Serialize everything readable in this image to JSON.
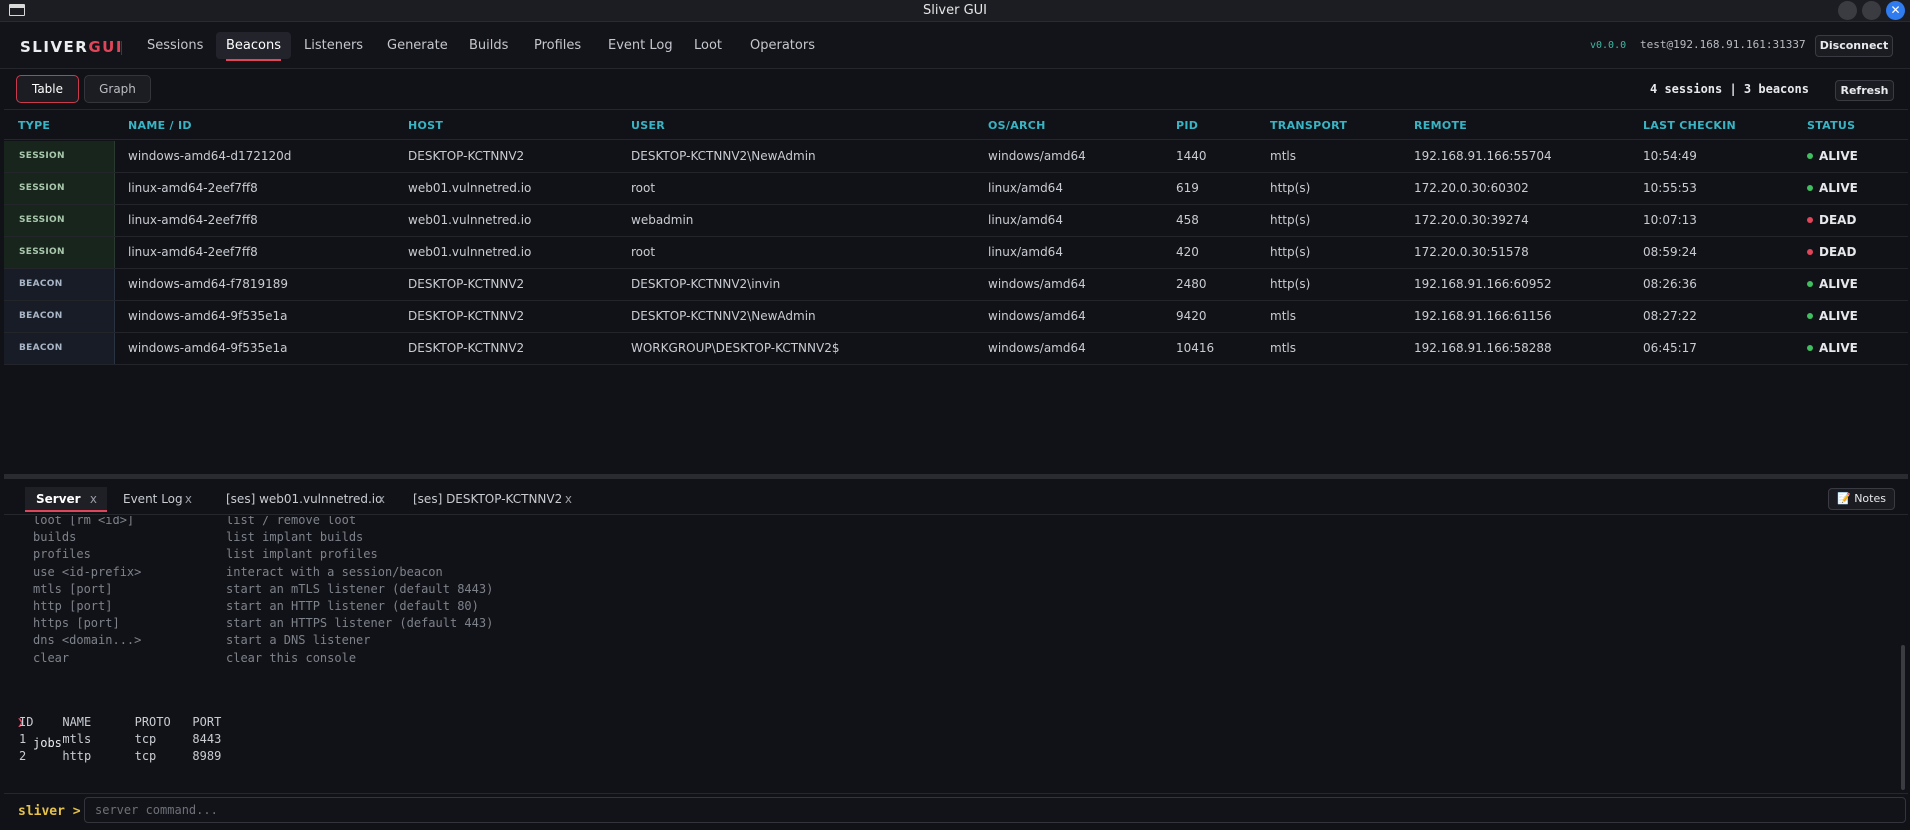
{
  "window": {
    "title": "Sliver GUI"
  },
  "brand": {
    "primary": "SLIVER",
    "accent": "GUI"
  },
  "nav": {
    "tabs": [
      "Sessions",
      "Beacons",
      "Listeners",
      "Generate",
      "Builds",
      "Profiles",
      "Event Log",
      "Loot",
      "Operators"
    ],
    "active": "Beacons",
    "version": "v0.0.0",
    "server": "test@192.168.91.161:31337",
    "disconnect_label": "Disconnect"
  },
  "toolbar": {
    "view_tabs": [
      "Table",
      "Graph"
    ],
    "active_view": "Table",
    "counts": "4 sessions | 3 beacons",
    "refresh_label": "Refresh"
  },
  "table": {
    "columns": [
      "TYPE",
      "NAME / ID",
      "HOST",
      "USER",
      "OS/ARCH",
      "PID",
      "TRANSPORT",
      "REMOTE",
      "LAST CHECKIN",
      "STATUS"
    ],
    "rows": [
      {
        "type": "SESSION",
        "name": "windows-amd64-d172120d",
        "host": "DESKTOP-KCTNNV2",
        "user": "DESKTOP-KCTNNV2\\NewAdmin",
        "os": "windows/amd64",
        "pid": "1440",
        "transport": "mtls",
        "remote": "192.168.91.166:55704",
        "checkin": "10:54:49",
        "status": "ALIVE"
      },
      {
        "type": "SESSION",
        "name": "linux-amd64-2eef7ff8",
        "host": "web01.vulnnetred.io",
        "user": "root",
        "os": "linux/amd64",
        "pid": "619",
        "transport": "http(s)",
        "remote": "172.20.0.30:60302",
        "checkin": "10:55:53",
        "status": "ALIVE"
      },
      {
        "type": "SESSION",
        "name": "linux-amd64-2eef7ff8",
        "host": "web01.vulnnetred.io",
        "user": "webadmin",
        "os": "linux/amd64",
        "pid": "458",
        "transport": "http(s)",
        "remote": "172.20.0.30:39274",
        "checkin": "10:07:13",
        "status": "DEAD"
      },
      {
        "type": "SESSION",
        "name": "linux-amd64-2eef7ff8",
        "host": "web01.vulnnetred.io",
        "user": "root",
        "os": "linux/amd64",
        "pid": "420",
        "transport": "http(s)",
        "remote": "172.20.0.30:51578",
        "checkin": "08:59:24",
        "status": "DEAD"
      },
      {
        "type": "BEACON",
        "name": "windows-amd64-f7819189",
        "host": "DESKTOP-KCTNNV2",
        "user": "DESKTOP-KCTNNV2\\invin",
        "os": "windows/amd64",
        "pid": "2480",
        "transport": "http(s)",
        "remote": "192.168.91.166:60952",
        "checkin": "08:26:36",
        "status": "ALIVE"
      },
      {
        "type": "BEACON",
        "name": "windows-amd64-9f535e1a",
        "host": "DESKTOP-KCTNNV2",
        "user": "DESKTOP-KCTNNV2\\NewAdmin",
        "os": "windows/amd64",
        "pid": "9420",
        "transport": "mtls",
        "remote": "192.168.91.166:61156",
        "checkin": "08:27:22",
        "status": "ALIVE"
      },
      {
        "type": "BEACON",
        "name": "windows-amd64-9f535e1a",
        "host": "DESKTOP-KCTNNV2",
        "user": "WORKGROUP\\DESKTOP-KCTNNV2$",
        "os": "windows/amd64",
        "pid": "10416",
        "transport": "mtls",
        "remote": "192.168.91.166:58288",
        "checkin": "06:45:17",
        "status": "ALIVE"
      }
    ]
  },
  "console": {
    "tabs": [
      "Server",
      "Event Log",
      "[ses] web01.vulnnetred.io",
      "[ses] DESKTOP-KCTNNV2"
    ],
    "active_tab": "Server",
    "close_glyph": "x",
    "notes_label": "📝 Notes",
    "help": [
      {
        "cmd": "loot [rm <id>]",
        "desc": "list / remove loot"
      },
      {
        "cmd": "builds",
        "desc": "list implant builds"
      },
      {
        "cmd": "profiles",
        "desc": "list implant profiles"
      },
      {
        "cmd": "use <id-prefix>",
        "desc": "interact with a session/beacon"
      },
      {
        "cmd": "mtls [port]",
        "desc": "start an mTLS listener (default 8443)"
      },
      {
        "cmd": "http [port]",
        "desc": "start an HTTP listener (default 80)"
      },
      {
        "cmd": "https [port]",
        "desc": "start an HTTPS listener (default 443)"
      },
      {
        "cmd": "dns <domain...>",
        "desc": "start a DNS listener"
      },
      {
        "cmd": "clear",
        "desc": "clear this console"
      }
    ],
    "prompt_arrow": "❯",
    "last_command": "jobs",
    "jobs_output": [
      "ID    NAME      PROTO   PORT",
      "1     mtls      tcp     8443",
      "2     http      tcp     8989"
    ],
    "input_label": "sliver >",
    "input_placeholder": "server command...",
    "input_value": ""
  },
  "colors": {
    "accent": "#e0455a",
    "header": "#39b4c4",
    "alive": "#3fbf5f",
    "dead": "#e0455a",
    "prompt": "#e6c14a"
  }
}
